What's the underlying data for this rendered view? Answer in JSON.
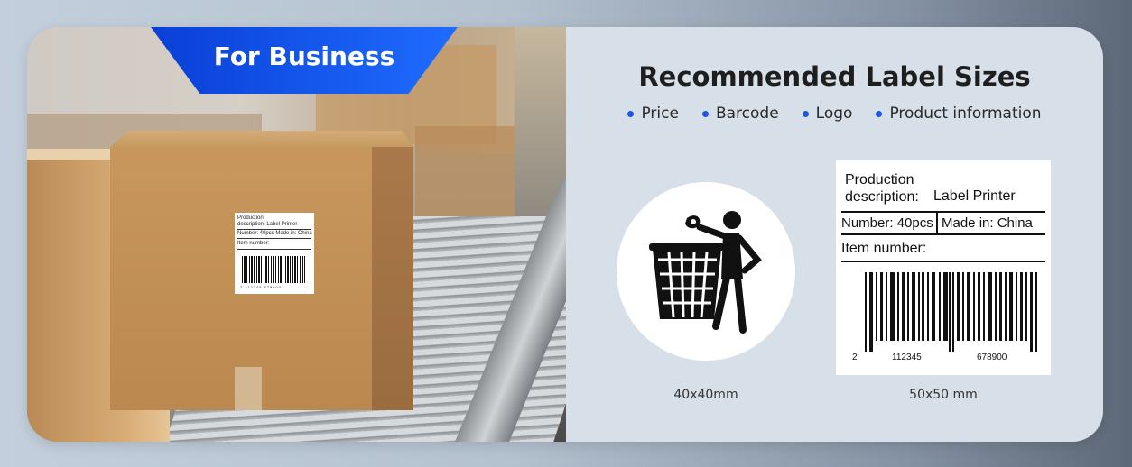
{
  "badge": {
    "text": "For Business"
  },
  "heading": {
    "title": "Recommended Label Sizes"
  },
  "bullets": [
    "Price",
    "Barcode",
    "Logo",
    "Product information"
  ],
  "colors": {
    "accent": "#1a55e8",
    "badge_start": "#0a3fd6",
    "badge_end": "#1f6cff"
  },
  "sizes": [
    {
      "caption": "40x40mm",
      "icon": "trash-disposal-icon"
    },
    {
      "caption": "50x50 mm",
      "icon": "barcode-label"
    }
  ],
  "label": {
    "production": "Production",
    "description_key": "description:",
    "description_value": "Label Printer",
    "number": "Number: 40pcs",
    "made_in": "Made in: China",
    "item_number": "Item number:",
    "barcode_left": "2",
    "barcode_mid": "112345",
    "barcode_right": "678900"
  },
  "mini_label": {
    "line1": "Production",
    "line2": "description:   Label Printer",
    "line3": "Number: 40pcs  Made in: China",
    "line4": "Item number:",
    "digits": "2  112345  678900"
  }
}
